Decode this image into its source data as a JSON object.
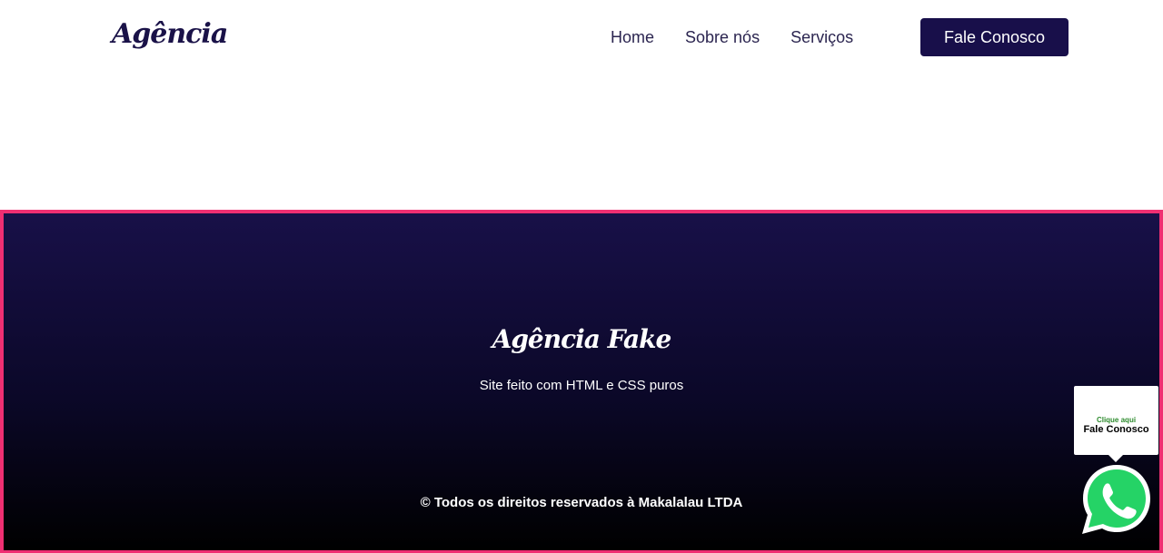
{
  "header": {
    "logo": "Agência",
    "nav": [
      {
        "label": "Home"
      },
      {
        "label": "Sobre nós"
      },
      {
        "label": "Serviços"
      }
    ],
    "cta_label": "Fale Conosco"
  },
  "footer": {
    "title": "Agência Fake",
    "subtitle": "Site feito com HTML e CSS puros",
    "copyright": "© Todos os direitos reservados à Makalalau LTDA"
  },
  "whatsapp": {
    "click_text": "Clique aqui",
    "label": "Fale Conosco",
    "icon": "whatsapp-icon"
  },
  "colors": {
    "brand": "#180f4a",
    "footer_border": "#ef2f72",
    "whatsapp_green": "#25d366"
  }
}
